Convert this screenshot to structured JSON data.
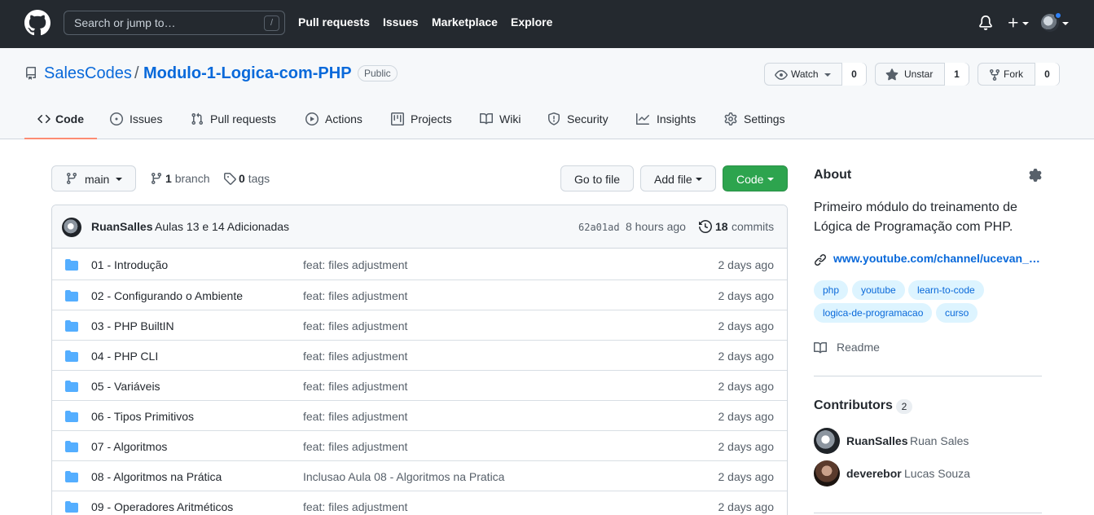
{
  "header": {
    "search_placeholder": "Search or jump to…",
    "search_shortcut": "/",
    "nav": [
      "Pull requests",
      "Issues",
      "Marketplace",
      "Explore"
    ]
  },
  "repo": {
    "owner": "SalesCodes",
    "separator": "/",
    "name": "Modulo-1-Logica-com-PHP",
    "visibility": "Public",
    "watch_label": "Watch",
    "watch_count": "0",
    "star_label": "Unstar",
    "star_count": "1",
    "fork_label": "Fork",
    "fork_count": "0"
  },
  "tabs": [
    "Code",
    "Issues",
    "Pull requests",
    "Actions",
    "Projects",
    "Wiki",
    "Security",
    "Insights",
    "Settings"
  ],
  "active_tab": "Code",
  "file_nav": {
    "branch": "main",
    "branch_count": "1",
    "branch_label": "branch",
    "tag_count": "0",
    "tag_label": "tags",
    "go_to_file": "Go to file",
    "add_file": "Add file",
    "code": "Code"
  },
  "latest_commit": {
    "author": "RuanSalles",
    "message": "Aulas 13 e 14 Adicionadas",
    "sha": "62a01ad",
    "time": "8 hours ago",
    "commit_count": "18",
    "commit_label": "commits"
  },
  "files": [
    {
      "name": "01 - Introdução",
      "message": "feat: files adjustment",
      "age": "2 days ago"
    },
    {
      "name": "02 - Configurando o Ambiente",
      "message": "feat: files adjustment",
      "age": "2 days ago"
    },
    {
      "name": "03 - PHP BuiltIN",
      "message": "feat: files adjustment",
      "age": "2 days ago"
    },
    {
      "name": "04 - PHP CLI",
      "message": "feat: files adjustment",
      "age": "2 days ago"
    },
    {
      "name": "05 - Variáveis",
      "message": "feat: files adjustment",
      "age": "2 days ago"
    },
    {
      "name": "06 - Tipos Primitivos",
      "message": "feat: files adjustment",
      "age": "2 days ago"
    },
    {
      "name": "07 - Algoritmos",
      "message": "feat: files adjustment",
      "age": "2 days ago"
    },
    {
      "name": "08 - Algoritmos na Prática",
      "message": "Inclusao Aula 08 - Algoritmos na Pratica",
      "age": "2 days ago"
    },
    {
      "name": "09 - Operadores Aritméticos",
      "message": "feat: files adjustment",
      "age": "2 days ago"
    }
  ],
  "about": {
    "title": "About",
    "description": "Primeiro módulo do treinamento de Lógica de Programação com PHP.",
    "link": "www.youtube.com/channel/ucevan_…",
    "topics": [
      "php",
      "youtube",
      "learn-to-code",
      "logica-de-programacao",
      "curso"
    ],
    "readme": "Readme"
  },
  "contributors": {
    "title": "Contributors",
    "count": "2",
    "people": [
      {
        "login": "RuanSalles",
        "name": "Ruan Sales"
      },
      {
        "login": "deverebor",
        "name": "Lucas Souza"
      }
    ]
  },
  "colors": {
    "header_bg": "#24292f",
    "link": "#0969da",
    "code_button": "#2da44e",
    "folder": "#54aeff",
    "tab_underline": "#fd8c73",
    "topic_bg": "#ddf4ff"
  },
  "icons": [
    "github-logo-icon",
    "repo-icon",
    "eye-icon",
    "star-icon",
    "fork-icon",
    "code-icon",
    "issue-icon",
    "pull-request-icon",
    "play-icon",
    "project-icon",
    "book-icon",
    "shield-icon",
    "graph-icon",
    "gear-icon",
    "branch-icon",
    "tag-icon",
    "history-icon",
    "folder-icon",
    "link-icon",
    "bell-icon",
    "plus-icon"
  ]
}
